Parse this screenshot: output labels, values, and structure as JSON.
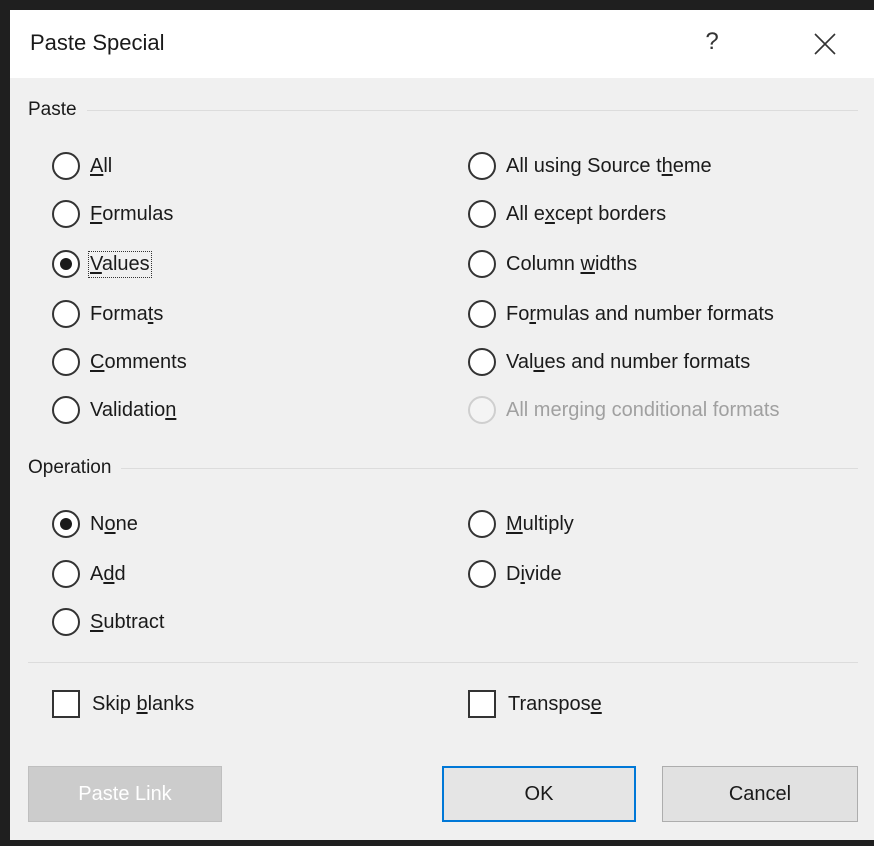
{
  "dialog": {
    "title": "Paste Special",
    "help_label": "?"
  },
  "paste": {
    "label": "Paste",
    "options": [
      {
        "pre": "",
        "key": "A",
        "post": "ll",
        "checked": false,
        "disabled": false
      },
      {
        "pre": "",
        "key": "F",
        "post": "ormulas",
        "checked": false,
        "disabled": false
      },
      {
        "pre": "",
        "key": "V",
        "post": "alues",
        "checked": true,
        "disabled": false
      },
      {
        "pre": "Forma",
        "key": "t",
        "post": "s",
        "checked": false,
        "disabled": false
      },
      {
        "pre": "",
        "key": "C",
        "post": "omments",
        "checked": false,
        "disabled": false
      },
      {
        "pre": "Validatio",
        "key": "n",
        "post": "",
        "checked": false,
        "disabled": false
      },
      {
        "pre": "All using Source t",
        "key": "h",
        "post": "eme",
        "checked": false,
        "disabled": false
      },
      {
        "pre": "All e",
        "key": "x",
        "post": "cept borders",
        "checked": false,
        "disabled": false
      },
      {
        "pre": "Column ",
        "key": "w",
        "post": "idths",
        "checked": false,
        "disabled": false
      },
      {
        "pre": "Fo",
        "key": "r",
        "post": "mulas and number formats",
        "checked": false,
        "disabled": false
      },
      {
        "pre": "Val",
        "key": "u",
        "post": "es and number formats",
        "checked": false,
        "disabled": false
      },
      {
        "pre": "All merging conditional formats",
        "key": "",
        "post": "",
        "checked": false,
        "disabled": true
      }
    ]
  },
  "operation": {
    "label": "Operation",
    "options": [
      {
        "pre": "N",
        "key": "o",
        "post": "ne",
        "checked": true
      },
      {
        "pre": "A",
        "key": "d",
        "post": "d",
        "checked": false
      },
      {
        "pre": "",
        "key": "S",
        "post": "ubtract",
        "checked": false
      },
      {
        "pre": "",
        "key": "M",
        "post": "ultiply",
        "checked": false
      },
      {
        "pre": "D",
        "key": "i",
        "post": "vide",
        "checked": false
      }
    ]
  },
  "checkboxes": {
    "skip_blanks": {
      "pre": "Skip ",
      "key": "b",
      "post": "lanks",
      "checked": false
    },
    "transpose": {
      "pre": "Transpos",
      "key": "e",
      "post": "",
      "checked": false
    }
  },
  "buttons": {
    "paste_link": "Paste Link",
    "ok": "OK",
    "cancel": "Cancel"
  },
  "colors": {
    "focus_border": "#0078d7",
    "dialog_bg": "#f0f0f0"
  }
}
